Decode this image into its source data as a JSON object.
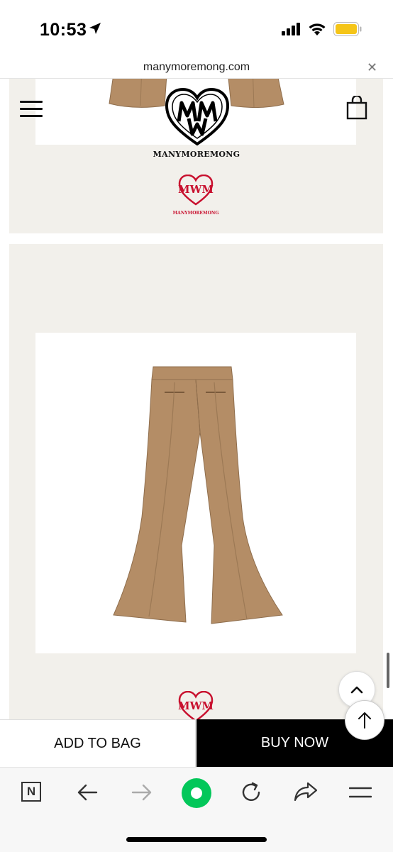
{
  "status_bar": {
    "time": "10:53"
  },
  "url_bar": {
    "url": "manymoremong.com"
  },
  "header": {
    "brand": "MANYMOREMONG"
  },
  "logos": {
    "red_brand_text": "MANYMOREMONG"
  },
  "purchase": {
    "add_to_bag": "ADD TO BAG",
    "buy_now": "BUY NOW"
  },
  "icons": {
    "location": "location-arrow-icon",
    "signal": "cellular-signal-icon",
    "wifi": "wifi-icon",
    "battery": "battery-icon",
    "close": "close-icon",
    "menu": "hamburger-menu-icon",
    "bag": "shopping-bag-icon",
    "scroll_up": "chevron-up-icon",
    "to_top": "arrow-up-icon",
    "naver": "naver-n-icon",
    "back": "arrow-left-icon",
    "forward": "arrow-right-icon",
    "home": "green-circle-icon",
    "reload": "reload-icon",
    "share": "share-icon",
    "more": "menu-lines-icon"
  },
  "colors": {
    "battery": "#f5c518",
    "brand_red": "#c8102e",
    "accent_green": "#03c75a",
    "card_bg": "#f2f0eb",
    "product_tan": "#b48d66"
  }
}
